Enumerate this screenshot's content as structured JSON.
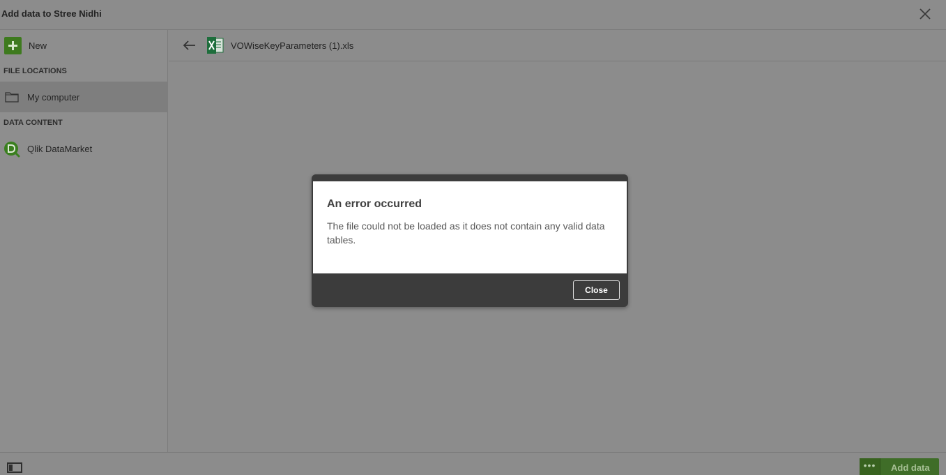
{
  "window": {
    "title": "Add data to Stree Nidhi",
    "close_icon": "close-icon"
  },
  "sidebar": {
    "new_label": "New",
    "sections": [
      {
        "heading": "FILE LOCATIONS"
      },
      {
        "heading": "DATA CONTENT"
      }
    ],
    "items": [
      {
        "label": "My computer",
        "icon": "folder-icon",
        "selected": true
      },
      {
        "label": "Qlik DataMarket",
        "icon": "qlik-datamarket-icon",
        "selected": false
      }
    ]
  },
  "header": {
    "back_icon": "back-arrow-icon",
    "file_icon": "excel-file-icon",
    "filename": "VOWiseKeyParameters (1).xls"
  },
  "dialog": {
    "title": "An error occurred",
    "message": "The file could not be loaded as it does not contain any valid data tables.",
    "close_label": "Close"
  },
  "footer": {
    "panel_toggle_icon": "panel-toggle-icon",
    "more_label": "•••",
    "add_data_label": "Add data"
  },
  "colors": {
    "overlay_background": "#8c8c8c",
    "brand_green": "#3e7a1e",
    "excel_green": "#1e6e3c",
    "dialog_dark": "#3c3c3c"
  }
}
